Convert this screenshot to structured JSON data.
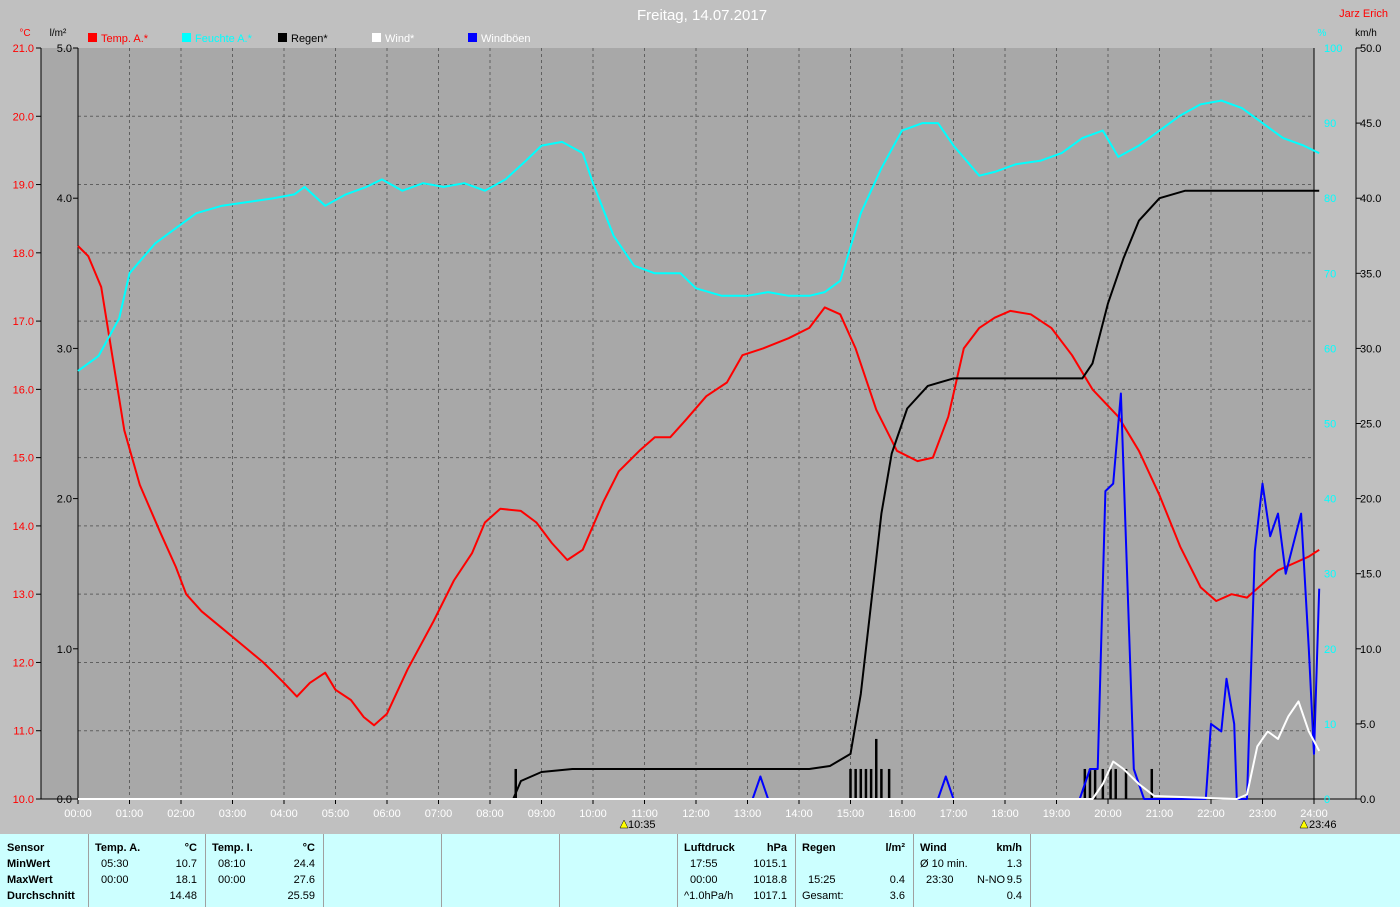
{
  "title": "Freitag, 14.07.2017",
  "author": "Jarz Erich",
  "legend": [
    "Temp. A.*",
    "Feuchte A.*",
    "Regen*",
    "Wind*",
    "Windböen"
  ],
  "colors": {
    "temp": "#ff0000",
    "humidity": "#00ffff",
    "rain": "#000000",
    "wind": "#ffffff",
    "gust": "#0000ff"
  },
  "units": {
    "left_temp": "°C",
    "left_rain": "l/m²",
    "right_hum": "%",
    "right_wind": "km/h"
  },
  "markers": {
    "marker1": "10:35",
    "marker2": "23:46"
  },
  "chart_data": {
    "type": "line",
    "x_unit": "hours",
    "xlim": [
      0,
      24
    ],
    "x_ticks": [
      "00:00",
      "01:00",
      "02:00",
      "03:00",
      "04:00",
      "05:00",
      "06:00",
      "07:00",
      "08:00",
      "09:00",
      "10:00",
      "11:00",
      "12:00",
      "13:00",
      "14:00",
      "15:00",
      "16:00",
      "17:00",
      "18:00",
      "19:00",
      "20:00",
      "21:00",
      "22:00",
      "23:00",
      "24:00"
    ],
    "axes": {
      "temp": {
        "range": [
          10,
          21
        ],
        "ticks": [
          "10.0",
          "11.0",
          "12.0",
          "13.0",
          "14.0",
          "15.0",
          "16.0",
          "17.0",
          "18.0",
          "19.0",
          "20.0",
          "21.0"
        ]
      },
      "rain": {
        "range": [
          0,
          5
        ],
        "ticks": [
          "0.0",
          "1.0",
          "2.0",
          "3.0",
          "4.0",
          "5.0"
        ]
      },
      "hum": {
        "range": [
          0,
          100
        ],
        "ticks": [
          "0",
          "10",
          "20",
          "30",
          "40",
          "50",
          "60",
          "70",
          "80",
          "90",
          "100"
        ]
      },
      "wind": {
        "range": [
          0,
          50
        ],
        "ticks": [
          "0.0",
          "5.0",
          "10.0",
          "15.0",
          "20.0",
          "25.0",
          "30.0",
          "35.0",
          "40.0",
          "45.0",
          "50.0"
        ]
      }
    },
    "grid": true,
    "series": [
      {
        "name": "Temp. A.*",
        "axis": "temp",
        "color": "#ff0000",
        "points": [
          [
            0,
            18.1
          ],
          [
            0.2,
            17.95
          ],
          [
            0.45,
            17.5
          ],
          [
            0.6,
            16.8
          ],
          [
            0.9,
            15.4
          ],
          [
            1.2,
            14.6
          ],
          [
            1.6,
            13.9
          ],
          [
            1.9,
            13.4
          ],
          [
            2.1,
            13.0
          ],
          [
            2.4,
            12.75
          ],
          [
            2.8,
            12.5
          ],
          [
            3.2,
            12.25
          ],
          [
            3.6,
            12.0
          ],
          [
            4.0,
            11.7
          ],
          [
            4.25,
            11.5
          ],
          [
            4.5,
            11.7
          ],
          [
            4.8,
            11.85
          ],
          [
            5.0,
            11.6
          ],
          [
            5.3,
            11.45
          ],
          [
            5.55,
            11.2
          ],
          [
            5.75,
            11.08
          ],
          [
            6.0,
            11.25
          ],
          [
            6.4,
            11.9
          ],
          [
            6.9,
            12.6
          ],
          [
            7.3,
            13.2
          ],
          [
            7.65,
            13.6
          ],
          [
            7.9,
            14.05
          ],
          [
            8.2,
            14.25
          ],
          [
            8.6,
            14.22
          ],
          [
            8.9,
            14.05
          ],
          [
            9.2,
            13.75
          ],
          [
            9.5,
            13.5
          ],
          [
            9.8,
            13.65
          ],
          [
            10.2,
            14.35
          ],
          [
            10.5,
            14.8
          ],
          [
            10.9,
            15.1
          ],
          [
            11.2,
            15.3
          ],
          [
            11.5,
            15.3
          ],
          [
            11.8,
            15.55
          ],
          [
            12.2,
            15.9
          ],
          [
            12.6,
            16.1
          ],
          [
            12.9,
            16.5
          ],
          [
            13.3,
            16.6
          ],
          [
            13.8,
            16.75
          ],
          [
            14.2,
            16.9
          ],
          [
            14.5,
            17.2
          ],
          [
            14.8,
            17.1
          ],
          [
            15.1,
            16.6
          ],
          [
            15.5,
            15.7
          ],
          [
            15.9,
            15.1
          ],
          [
            16.3,
            14.95
          ],
          [
            16.6,
            15.0
          ],
          [
            16.9,
            15.6
          ],
          [
            17.2,
            16.6
          ],
          [
            17.5,
            16.9
          ],
          [
            17.8,
            17.05
          ],
          [
            18.1,
            17.15
          ],
          [
            18.5,
            17.1
          ],
          [
            18.9,
            16.9
          ],
          [
            19.3,
            16.5
          ],
          [
            19.7,
            16.0
          ],
          [
            20.2,
            15.6
          ],
          [
            20.6,
            15.1
          ],
          [
            21.0,
            14.45
          ],
          [
            21.4,
            13.7
          ],
          [
            21.8,
            13.1
          ],
          [
            22.1,
            12.9
          ],
          [
            22.4,
            13.0
          ],
          [
            22.7,
            12.95
          ],
          [
            23.0,
            13.15
          ],
          [
            23.3,
            13.35
          ],
          [
            23.6,
            13.45
          ],
          [
            23.9,
            13.55
          ],
          [
            24.1,
            13.65
          ]
        ]
      },
      {
        "name": "Feuchte A.*",
        "axis": "hum",
        "color": "#00ffff",
        "points": [
          [
            0,
            57
          ],
          [
            0.4,
            59
          ],
          [
            0.8,
            64
          ],
          [
            1.0,
            70
          ],
          [
            1.5,
            74
          ],
          [
            1.9,
            76
          ],
          [
            2.3,
            78
          ],
          [
            2.8,
            79
          ],
          [
            3.3,
            79.5
          ],
          [
            3.8,
            80
          ],
          [
            4.2,
            80.5
          ],
          [
            4.4,
            81.5
          ],
          [
            4.8,
            79
          ],
          [
            5.2,
            80.5
          ],
          [
            5.6,
            81.5
          ],
          [
            5.9,
            82.5
          ],
          [
            6.3,
            81
          ],
          [
            6.7,
            82
          ],
          [
            7.1,
            81.5
          ],
          [
            7.5,
            82
          ],
          [
            7.9,
            81
          ],
          [
            8.3,
            82.5
          ],
          [
            8.7,
            85
          ],
          [
            9.0,
            87
          ],
          [
            9.4,
            87.5
          ],
          [
            9.8,
            86
          ],
          [
            10.0,
            82
          ],
          [
            10.4,
            75
          ],
          [
            10.8,
            71
          ],
          [
            11.2,
            70
          ],
          [
            11.7,
            70
          ],
          [
            12.0,
            68
          ],
          [
            12.5,
            67
          ],
          [
            13.0,
            67
          ],
          [
            13.4,
            67.5
          ],
          [
            13.8,
            67
          ],
          [
            14.2,
            67
          ],
          [
            14.5,
            67.5
          ],
          [
            14.8,
            69
          ],
          [
            15.2,
            78
          ],
          [
            15.6,
            84
          ],
          [
            16.0,
            89
          ],
          [
            16.4,
            90
          ],
          [
            16.7,
            90
          ],
          [
            17.0,
            87
          ],
          [
            17.5,
            83
          ],
          [
            17.8,
            83.5
          ],
          [
            18.2,
            84.5
          ],
          [
            18.7,
            85
          ],
          [
            19.1,
            86
          ],
          [
            19.5,
            88
          ],
          [
            19.9,
            89
          ],
          [
            20.2,
            85.5
          ],
          [
            20.6,
            87
          ],
          [
            21.0,
            89
          ],
          [
            21.4,
            91
          ],
          [
            21.8,
            92.5
          ],
          [
            22.2,
            93
          ],
          [
            22.6,
            92
          ],
          [
            23.0,
            90
          ],
          [
            23.4,
            88
          ],
          [
            23.8,
            87
          ],
          [
            24.1,
            86
          ]
        ]
      },
      {
        "name": "Regen*",
        "axis": "rain",
        "color": "#000000",
        "points": [
          [
            0,
            0
          ],
          [
            8.45,
            0
          ],
          [
            8.6,
            0.12
          ],
          [
            9.0,
            0.18
          ],
          [
            9.6,
            0.2
          ],
          [
            14.2,
            0.2
          ],
          [
            14.6,
            0.22
          ],
          [
            15.0,
            0.3
          ],
          [
            15.2,
            0.7
          ],
          [
            15.4,
            1.3
          ],
          [
            15.6,
            1.9
          ],
          [
            15.8,
            2.3
          ],
          [
            16.1,
            2.6
          ],
          [
            16.5,
            2.75
          ],
          [
            17.0,
            2.8
          ],
          [
            19.5,
            2.8
          ],
          [
            19.7,
            2.9
          ],
          [
            20.0,
            3.3
          ],
          [
            20.3,
            3.6
          ],
          [
            20.6,
            3.85
          ],
          [
            21.0,
            4.0
          ],
          [
            21.5,
            4.05
          ],
          [
            24.1,
            4.05
          ]
        ]
      },
      {
        "name": "Windböen",
        "axis": "wind",
        "color": "#0000ff",
        "points": [
          [
            0,
            0
          ],
          [
            13.1,
            0
          ],
          [
            13.25,
            1.5
          ],
          [
            13.4,
            0
          ],
          [
            16.7,
            0
          ],
          [
            16.85,
            1.5
          ],
          [
            17.0,
            0
          ],
          [
            19.45,
            0
          ],
          [
            19.65,
            2
          ],
          [
            19.8,
            2
          ],
          [
            19.95,
            20.5
          ],
          [
            20.1,
            21
          ],
          [
            20.25,
            27
          ],
          [
            20.5,
            2
          ],
          [
            20.7,
            0
          ],
          [
            21.9,
            0
          ],
          [
            22.0,
            5
          ],
          [
            22.2,
            4.5
          ],
          [
            22.3,
            8
          ],
          [
            22.45,
            5
          ],
          [
            22.5,
            0
          ],
          [
            22.7,
            0
          ],
          [
            22.85,
            16.5
          ],
          [
            23.0,
            21
          ],
          [
            23.15,
            17.5
          ],
          [
            23.3,
            19
          ],
          [
            23.45,
            15
          ],
          [
            23.6,
            17
          ],
          [
            23.75,
            19
          ],
          [
            23.9,
            10
          ],
          [
            24.0,
            3
          ],
          [
            24.1,
            14
          ]
        ]
      },
      {
        "name": "Wind*",
        "axis": "wind",
        "color": "#ffffff",
        "points": [
          [
            0,
            0
          ],
          [
            19.7,
            0
          ],
          [
            19.9,
            1
          ],
          [
            20.1,
            2.5
          ],
          [
            20.3,
            2
          ],
          [
            20.6,
            1
          ],
          [
            20.9,
            0.2
          ],
          [
            22.5,
            0
          ],
          [
            22.7,
            0.3
          ],
          [
            22.9,
            3.5
          ],
          [
            23.1,
            4.5
          ],
          [
            23.3,
            4
          ],
          [
            23.5,
            5.5
          ],
          [
            23.7,
            6.5
          ],
          [
            23.9,
            4.5
          ],
          [
            24.1,
            3.2
          ]
        ]
      }
    ],
    "rain_bars_x": [
      8.5,
      15.0,
      15.1,
      15.2,
      15.3,
      15.4,
      15.5,
      15.6,
      15.75,
      19.55,
      19.65,
      19.75,
      19.9,
      20.05,
      20.15,
      20.35,
      20.85
    ],
    "rain_bars_h": [
      0.2,
      0.2,
      0.2,
      0.2,
      0.2,
      0.2,
      0.4,
      0.2,
      0.2,
      0.2,
      0.2,
      0.2,
      0.2,
      0.2,
      0.2,
      0.2,
      0.2
    ]
  },
  "stats": {
    "col1": {
      "header": "Sensor",
      "min": "MinWert",
      "max": "MaxWert",
      "avg": "Durchschnitt"
    },
    "temp_a": {
      "header": "Temp. A.",
      "unit": "°C",
      "min_time": "05:30",
      "min_val": "10.7",
      "max_time": "00:00",
      "max_val": "18.1",
      "avg": "14.48"
    },
    "temp_i": {
      "header": "Temp. I.",
      "unit": "°C",
      "min_time": "08:10",
      "min_val": "24.4",
      "max_time": "00:00",
      "max_val": "27.6",
      "avg": "25.59"
    },
    "pressure": {
      "header": "Luftdruck",
      "unit": "hPa",
      "min_time": "17:55",
      "min_val": "1015.1",
      "max_time": "00:00",
      "max_val": "1018.8",
      "avg_label": "^1.0hPa/h",
      "avg": "1017.1"
    },
    "rain": {
      "header": "Regen",
      "unit": "l/m²",
      "max_time": "15:25",
      "max_val": "0.4",
      "total_label": "Gesamt:",
      "total": "3.6"
    },
    "wind": {
      "header": "Wind",
      "unit": "km/h",
      "min_label": "Ø 10 min.",
      "min_val": "1.3",
      "max_time": "23:30",
      "max_dir": "N-NO",
      "max_val": "9.5",
      "avg": "0.4"
    }
  }
}
